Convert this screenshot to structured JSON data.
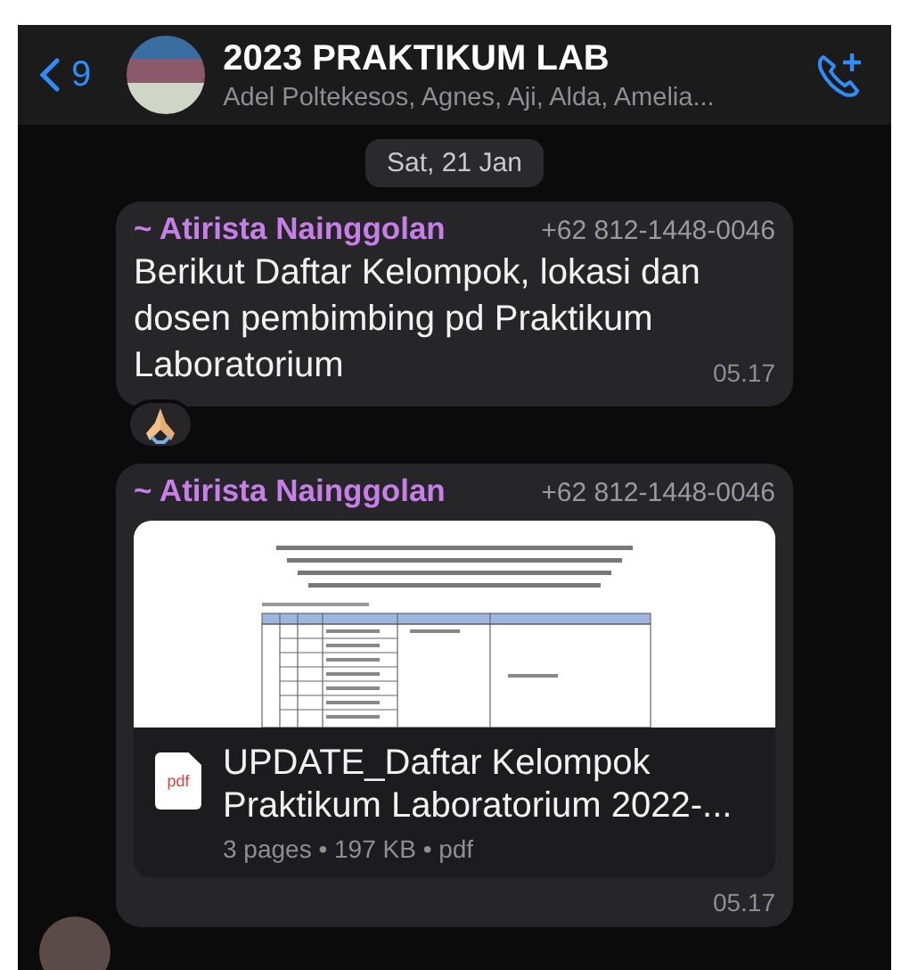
{
  "header": {
    "back_count": "9",
    "title": "2023 PRAKTIKUM LAB",
    "subtitle": "Adel Poltekesos, Agnes, Aji, Alda, Amelia..."
  },
  "date_chip": "Sat, 21 Jan",
  "messages": [
    {
      "kind": "text",
      "sender": "~ Atirista Nainggolan",
      "phone": "+62 812-1448-0046",
      "text": "Berikut Daftar Kelompok, lokasi dan dosen pembimbing pd Praktikum Laboratorium",
      "time": "05.17",
      "reactions": [
        {
          "kind": "pray"
        }
      ]
    },
    {
      "kind": "document",
      "sender": "~ Atirista Nainggolan",
      "phone": "+62 812-1448-0046",
      "file_type": "pdf",
      "file_name": "UPDATE_Daftar Kelompok Praktikum Laboratorium 2022-...",
      "meta": "3 pages • 197 KB • pdf",
      "time": "05.17"
    }
  ]
}
